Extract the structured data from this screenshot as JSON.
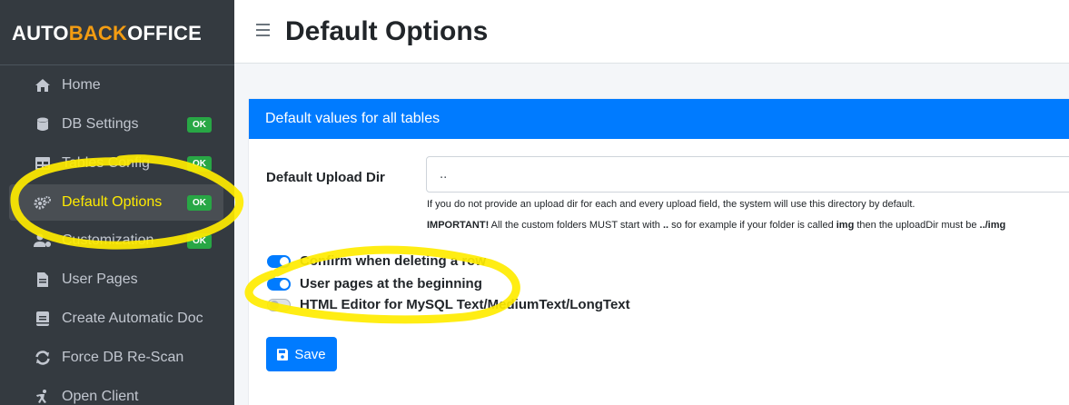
{
  "brand": {
    "part1": "AUTO",
    "part2": "BACK",
    "part3": "OFFICE"
  },
  "sidebar": {
    "items": [
      {
        "label": "Home",
        "icon": "home-icon"
      },
      {
        "label": "DB Settings",
        "icon": "database-icon",
        "badge": "OK"
      },
      {
        "label": "Tables Config",
        "icon": "table-icon",
        "badge": "OK"
      },
      {
        "label": "Default Options",
        "icon": "cogs-icon",
        "badge": "OK",
        "active": true
      },
      {
        "label": "Customization",
        "icon": "users-cog-icon",
        "badge": "OK"
      },
      {
        "label": "User Pages",
        "icon": "file-icon"
      },
      {
        "label": "Create Automatic Doc",
        "icon": "book-icon"
      },
      {
        "label": "Force DB Re-Scan",
        "icon": "sync-icon"
      },
      {
        "label": "Open Client",
        "icon": "running-icon"
      }
    ]
  },
  "header": {
    "title": "Default Options"
  },
  "card": {
    "title": "Default values for all tables",
    "upload_label": "Default Upload Dir",
    "upload_value": "..",
    "help_line1": "If you do not provide an upload dir for each and every upload field, the system will use this directory by default.",
    "help2_important": "IMPORTANT!",
    "help2_a": " All the custom folders MUST start with ",
    "help2_dots": "..",
    "help2_b": " so for example if your folder is called ",
    "help2_img": "img",
    "help2_c": " then the uploadDir must be ",
    "help2_path": "../img",
    "switches": [
      {
        "label": "Confirm when deleting a row",
        "state": "on"
      },
      {
        "label": "User pages at the beginning",
        "state": "on"
      },
      {
        "label": "HTML Editor for MySQL Text/MediumText/LongText",
        "state": "off"
      }
    ],
    "save_label": "Save"
  },
  "colors": {
    "sidebar_bg": "#343a40",
    "accent": "#007bff",
    "badge": "#28a745",
    "highlight": "#ffeb00",
    "brand_orange": "#f39c12"
  }
}
